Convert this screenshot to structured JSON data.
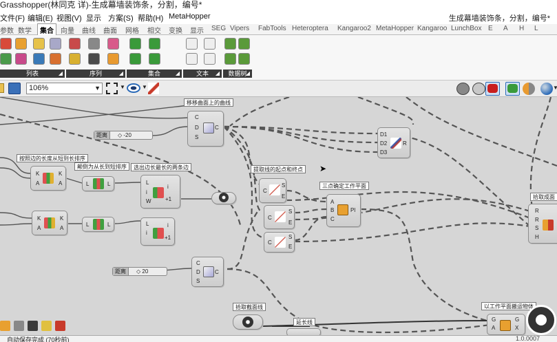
{
  "window": {
    "title": "Grasshopper(林同克 详)-生成幕墙装饰条，分割，编号*"
  },
  "menu": {
    "items": [
      "文件(F)",
      "编辑(E)",
      "视图(V)",
      "显示",
      "方案(S)",
      "帮助(H)",
      "MetaHopper"
    ],
    "right_title": "生成幕墙装饰条，分割，编号*"
  },
  "tabs": {
    "items": [
      "参数",
      "数学",
      "集合",
      "向量",
      "曲线",
      "曲面",
      "网格",
      "相交",
      "变换",
      "显示",
      "SEG",
      "Vipers",
      "FabTools",
      "Heteroptera",
      "Kangaroo2",
      "MetaHopper",
      "Kangaroo",
      "LunchBox",
      "E",
      "A",
      "H",
      "L"
    ],
    "active": "集合"
  },
  "ribbon": {
    "groups": [
      "列表",
      "序列",
      "集合",
      "文本",
      "数据树"
    ]
  },
  "toolbar": {
    "zoom": "106%"
  },
  "canvas": {
    "labels": {
      "move_curve": "移移曲面上的曲线",
      "sort_list": "按照边的长度从短到长排序",
      "sort_short": "颠倒为从长到短排序",
      "pick_longest": "选出边长最长的两条边",
      "extract_endpoints": "提取线的起点和终点",
      "three_point_plane": "三点确定工作平面",
      "pick_section": "拾取截面线",
      "extrude": "延长线",
      "orient_plane": "以工作平面搬运物体",
      "pick_surface": "拾取成面"
    },
    "sliders": [
      {
        "name": "距离",
        "value": "-20"
      },
      {
        "name": "距离",
        "value": "20"
      }
    ],
    "ports": {
      "move_in": [
        "C",
        "D",
        "S"
      ],
      "move_out": "C",
      "sort_in": [
        "K",
        "A"
      ],
      "sort_out": [
        "K",
        "A"
      ],
      "pick_in": [
        "L",
        "i",
        "W"
      ],
      "pick_out": [
        "i",
        "+1"
      ],
      "end_in": "C",
      "end_out": [
        "S",
        "E"
      ],
      "plane_in": [
        "A",
        "B",
        "C"
      ],
      "plane_out": "Pl",
      "bake_in": [
        "D1",
        "D2",
        "D3"
      ],
      "bake_out": "R",
      "orient_in": [
        "G",
        "A",
        "B"
      ],
      "orient_out": [
        "G",
        "X"
      ],
      "right_in": [
        "R",
        "R",
        "S",
        "H"
      ]
    }
  },
  "status": {
    "text": "自动保存完成 (70秒前)",
    "version": "1.0.0007"
  },
  "colors": {
    "canvas": "#d6d6d6",
    "wire": "#555555",
    "label_dark": "#3b3b3b"
  }
}
